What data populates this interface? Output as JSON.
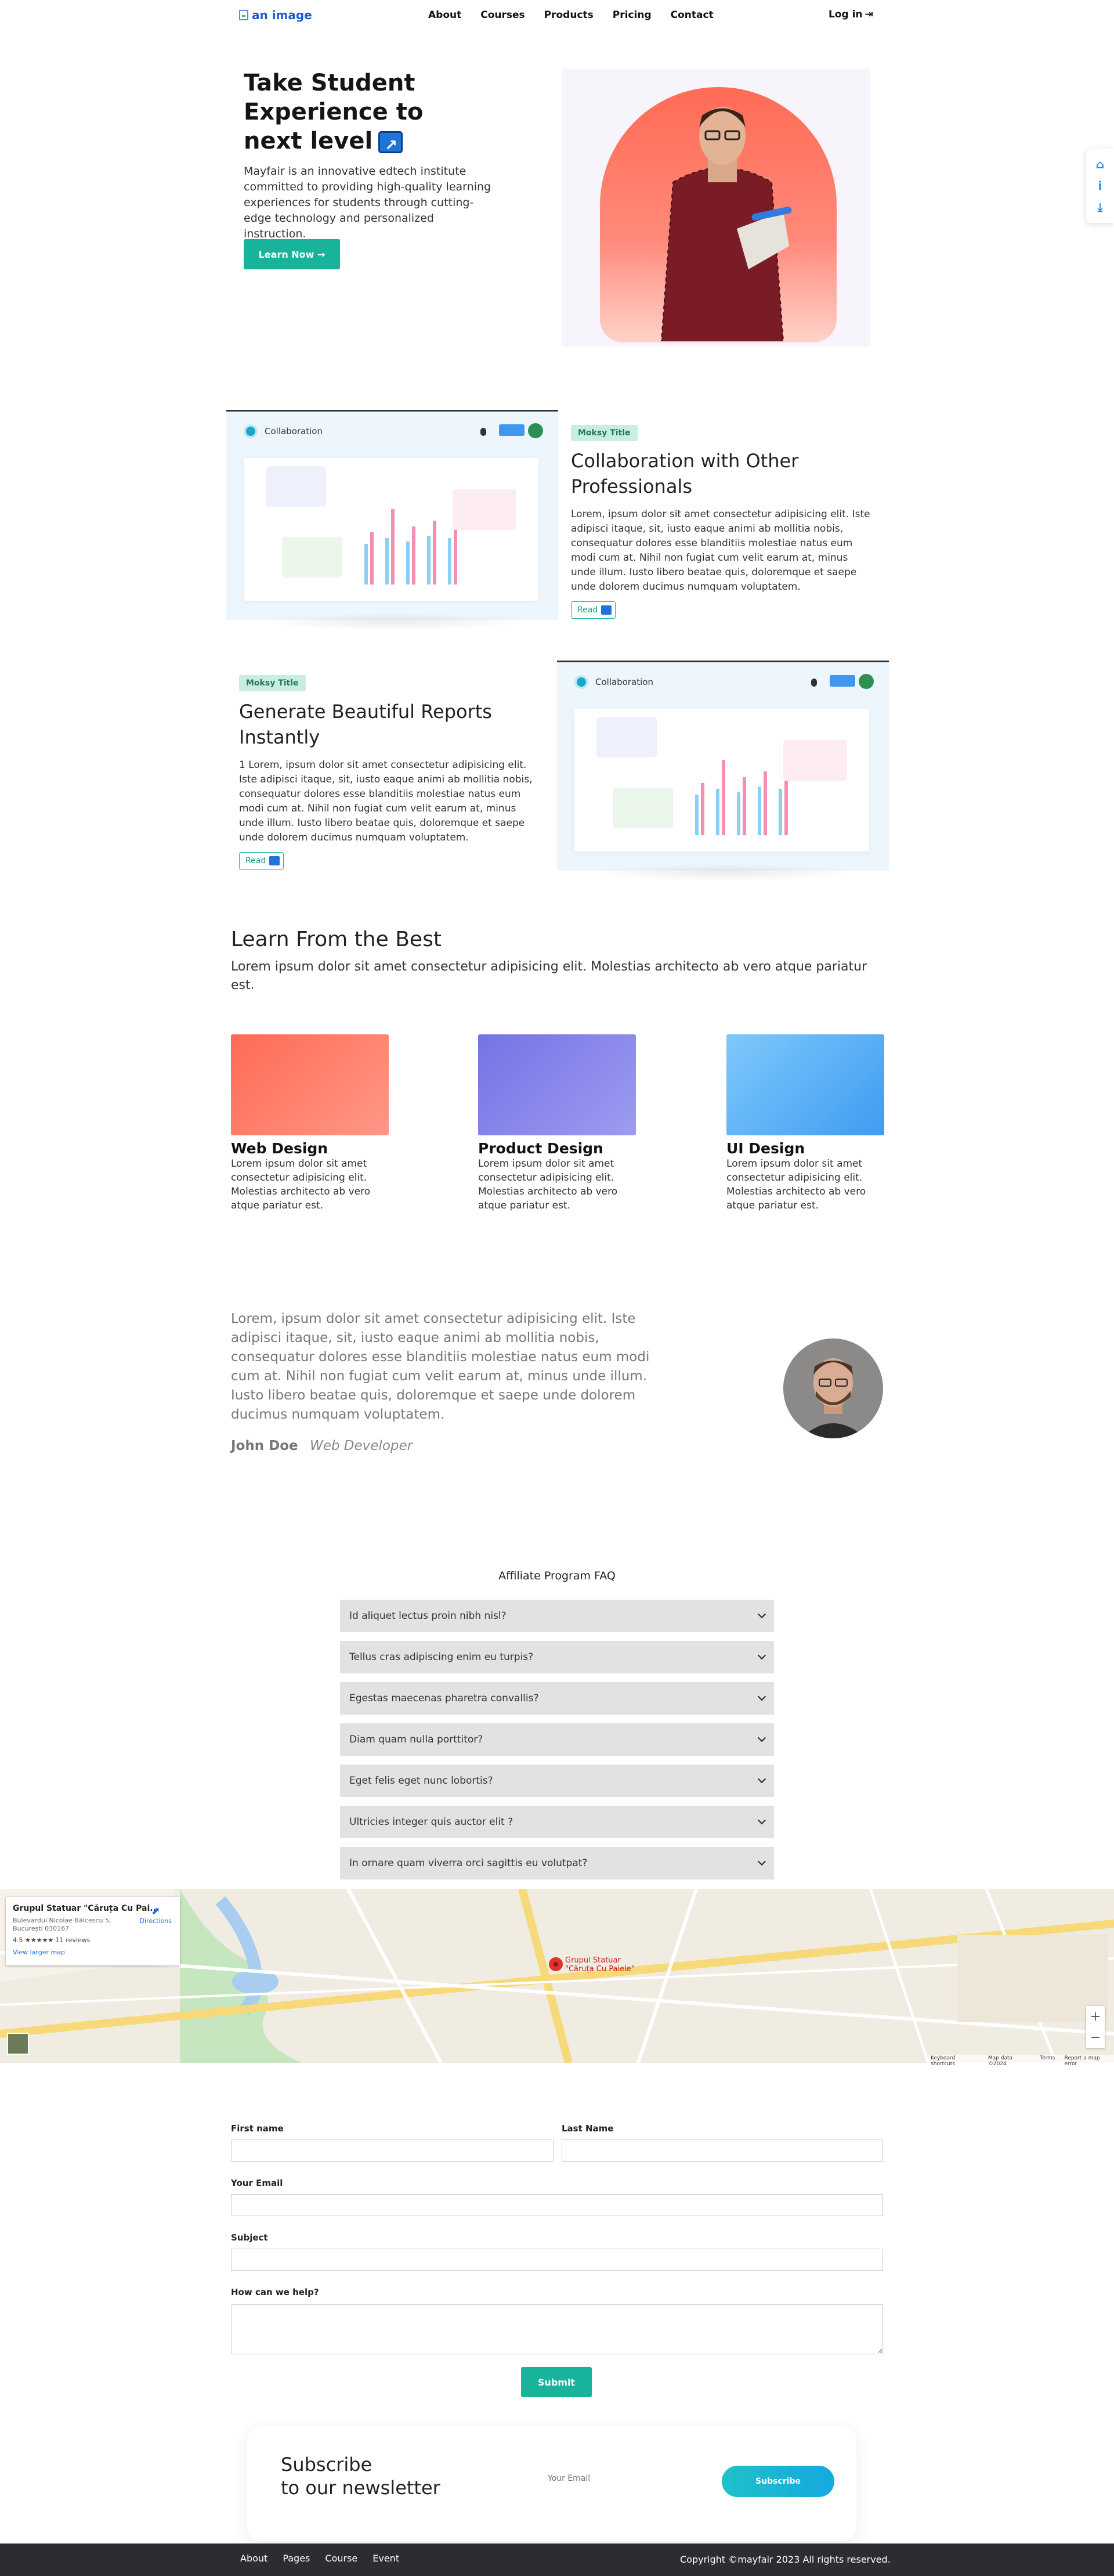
{
  "nav": {
    "brand_alt": "an image",
    "links": [
      "About",
      "Courses",
      "Products",
      "Pricing",
      "Contact"
    ],
    "login": "Log in"
  },
  "hero": {
    "title": "Take Student Experience to next level",
    "subtitle": "Mayfair is an innovative edtech institute committed to providing high-quality learning experiences for students through cutting-edge technology and personalized instruction.",
    "button": "Learn Now →"
  },
  "features": [
    {
      "mock_label": "Collaboration",
      "tag": "Moksy Title",
      "title": "Collaboration with Other Professionals",
      "text": "Lorem, ipsum dolor sit amet consectetur adipisicing elit. Iste adipisci itaque, sit, iusto eaque animi ab mollitia nobis, consequatur dolores esse blanditiis molestiae natus eum modi cum at. Nihil non fugiat cum velit earum at, minus unde illum. Iusto libero beatae quis, doloremque et saepe unde dolorem ducimus numquam voluptatem.",
      "read": "Read"
    },
    {
      "mock_label": "Collaboration",
      "tag": "Moksy Title",
      "title": "Generate Beautiful Reports Instantly",
      "text": "1 Lorem, ipsum dolor sit amet consectetur adipisicing elit. Iste adipisci itaque, sit, iusto eaque animi ab mollitia nobis, consequatur dolores esse blanditiis molestiae natus eum modi cum at. Nihil non fugiat cum velit earum at, minus unde illum. Iusto libero beatae quis, doloremque et saepe unde dolorem ducimus numquam voluptatem.",
      "read": "Read"
    }
  ],
  "learn": {
    "title": "Learn From the Best",
    "subtitle": "Lorem ipsum dolor sit amet consectetur adipisicing elit. Molestias architecto ab vero atque pariatur est.",
    "courses": [
      {
        "title": "Web Design",
        "text": "Lorem ipsum dolor sit amet consectetur adipisicing elit. Molestias architecto ab vero atque pariatur est.",
        "color_a": "#ff6b55",
        "color_b": "#ff9787"
      },
      {
        "title": "Product Design",
        "text": "Lorem ipsum dolor sit amet consectetur adipisicing elit. Molestias architecto ab vero atque pariatur est.",
        "color_a": "#7473e6",
        "color_b": "#9d9cf0"
      },
      {
        "title": "UI Design",
        "text": "Lorem ipsum dolor sit amet consectetur adipisicing elit. Molestias architecto ab vero atque pariatur est.",
        "color_a": "#3f9cf2",
        "color_b": "#7fc8fb"
      }
    ]
  },
  "testimonial": {
    "quote": "Lorem, ipsum dolor sit amet consectetur adipisicing elit. Iste adipisci itaque, sit, iusto eaque animi ab mollitia nobis, consequatur dolores esse blanditiis molestiae natus eum modi cum at. Nihil non fugiat cum velit earum at, minus unde illum. Iusto libero beatae quis, doloremque et saepe unde dolorem ducimus numquam voluptatem.",
    "name": "John Doe",
    "role": "Web Developer"
  },
  "faq": {
    "title": "Affiliate Program FAQ",
    "items": [
      "Id aliquet lectus proin nibh nisl?",
      "Tellus cras adipiscing enim eu turpis?",
      "Egestas maecenas pharetra convallis?",
      "Diam quam nulla porttitor?",
      "Eget felis eget nunc lobortis?",
      "Ultricies integer quis auctor elit ?",
      "In ornare quam viverra orci sagittis eu volutpat?"
    ]
  },
  "map": {
    "place": "Grupul Statuar \"Căruța Cu Pai...",
    "address": "Bulevardul Nicolae Bălcescu 5, București 030167",
    "rating": "4.5 ★★★★★  11 reviews",
    "larger": "View larger map",
    "directions": "Directions",
    "marker": "Grupul Statuar \"Căruța Cu Paiele\"",
    "attribution": [
      "Keyboard shortcuts",
      "Map data ©2024",
      "Terms",
      "Report a map error"
    ]
  },
  "form": {
    "first": "First name",
    "last": "Last Name",
    "email": "Your Email",
    "subject": "Subject",
    "help": "How can we help?",
    "submit": "Submit"
  },
  "newsletter": {
    "line1": "Subscribe",
    "line2": "to our newsletter",
    "placeholder": "Your Email",
    "button": "Subscribe"
  },
  "footer": {
    "links": [
      "About",
      "Pages",
      "Course",
      "Event"
    ],
    "copyright": "Copyright ©mayfair 2023 All rights reserved."
  },
  "colors": {
    "accent": "#17b39a",
    "brand_blue": "#1e74d9",
    "footer": "#2b2d33"
  }
}
